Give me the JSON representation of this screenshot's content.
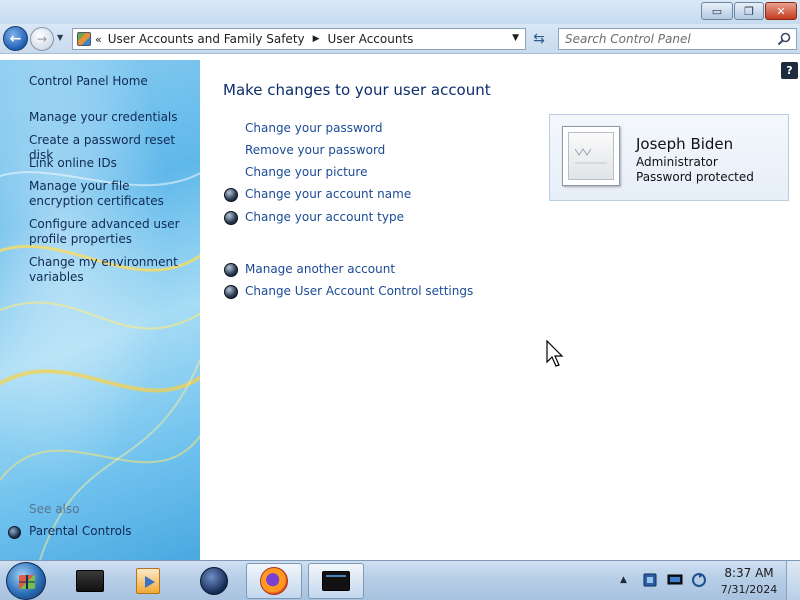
{
  "window": {
    "min_label": "▭",
    "max_label": "❐",
    "close_label": "✕"
  },
  "nav": {
    "breadcrumb": [
      "User Accounts and Family Safety",
      "User Accounts"
    ],
    "search_placeholder": "Search Control Panel"
  },
  "sidebar": {
    "items": [
      {
        "label": "Control Panel Home"
      },
      {
        "label": "Manage your credentials"
      },
      {
        "label": "Create a password reset disk"
      },
      {
        "label": "Link online IDs"
      },
      {
        "label": "Manage your file encryption certificates"
      },
      {
        "label": "Configure advanced user profile properties"
      },
      {
        "label": "Change my environment variables"
      }
    ],
    "see_also_label": "See also",
    "see_also_items": [
      {
        "label": "Parental Controls"
      }
    ]
  },
  "main": {
    "title": "Make changes to your user account",
    "tasks": [
      {
        "label": "Change your password",
        "shield": false
      },
      {
        "label": "Remove your password",
        "shield": false
      },
      {
        "label": "Change your picture",
        "shield": false
      },
      {
        "label": "Change your account name",
        "shield": true
      },
      {
        "label": "Change your account type",
        "shield": true
      }
    ],
    "other_tasks": [
      {
        "label": "Manage another account",
        "shield": true
      },
      {
        "label": "Change User Account Control settings",
        "shield": true
      }
    ]
  },
  "account": {
    "name": "Joseph Biden",
    "role": "Administrator",
    "status": "Password protected"
  },
  "taskbar": {
    "apps": [
      "server-manager-icon",
      "media-center-icon",
      "network-globe-icon",
      "firefox-icon",
      "control-panel-window-icon"
    ],
    "clock_time": "8:37 AM",
    "clock_date": "7/31/2024"
  },
  "colors": {
    "link": "#1b4b94",
    "title": "#0d2d6b",
    "sidebar_text": "#102a54"
  }
}
